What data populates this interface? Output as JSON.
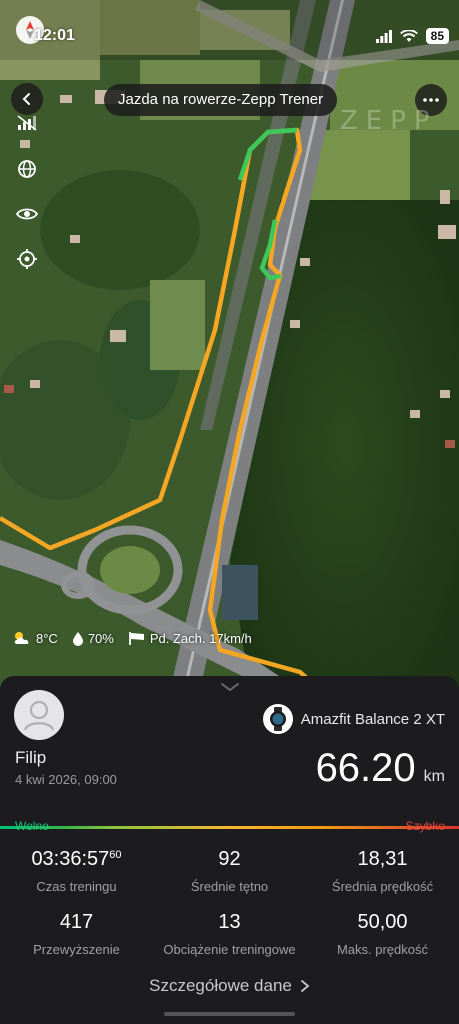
{
  "status_bar": {
    "time": "12:01",
    "battery": "85",
    "icons": [
      "signal-icon",
      "wifi-icon"
    ]
  },
  "header": {
    "title": "Jazda na rowerze-Zepp Trener",
    "watermark": "ZEPP"
  },
  "map_tools": [
    "no-gps-signal-icon",
    "globe-icon",
    "eye-icon",
    "locate-icon"
  ],
  "weather": {
    "temperature": "8°C",
    "humidity": "70%",
    "wind": "Pd. Zach. 17km/h"
  },
  "profile": {
    "user_name": "Filip",
    "date": "4 kwi 2026, 09:00",
    "device_name": "Amazfit Balance 2 XT"
  },
  "distance": {
    "value": "66.20",
    "unit": "km"
  },
  "speed_scale": {
    "low_label": "Wolno",
    "high_label": "Szybko"
  },
  "stats": [
    {
      "value": "03:36:57",
      "sup": "60",
      "label": "Czas treningu"
    },
    {
      "value": "92",
      "sup": "",
      "label": "Średnie tętno"
    },
    {
      "value": "18,31",
      "sup": "",
      "label": "Średnia prędkość"
    },
    {
      "value": "417",
      "sup": "",
      "label": "Przewyższenie"
    },
    {
      "value": "13",
      "sup": "",
      "label": "Obciążenie treningowe"
    },
    {
      "value": "50,00",
      "sup": "",
      "label": "Maks. prędkość"
    }
  ],
  "details_link": "Szczegółowe dane",
  "colors": {
    "route_orange": "#f5a623",
    "route_green": "#3cc85a",
    "speed_low": "#19c37d",
    "speed_high": "#e0463b",
    "panel_bg": "#1c1c1e"
  }
}
